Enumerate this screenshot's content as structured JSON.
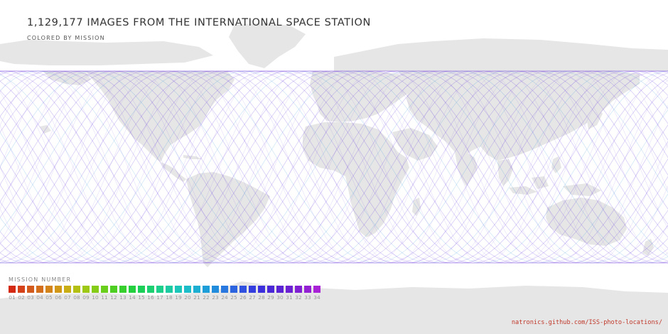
{
  "title": "1,129,177 IMAGES FROM THE INTERNATIONAL SPACE STATION",
  "subtitle": "COLORED BY MISSION",
  "legend": {
    "title": "MISSION NUMBER",
    "items": [
      {
        "label": "01",
        "color": "#d42a14"
      },
      {
        "label": "02",
        "color": "#d5421a"
      },
      {
        "label": "03",
        "color": "#d25a1c"
      },
      {
        "label": "04",
        "color": "#d36f1c"
      },
      {
        "label": "05",
        "color": "#d3841a"
      },
      {
        "label": "06",
        "color": "#d19818"
      },
      {
        "label": "07",
        "color": "#c9ad14"
      },
      {
        "label": "08",
        "color": "#b4bf14"
      },
      {
        "label": "09",
        "color": "#9ec816"
      },
      {
        "label": "10",
        "color": "#85cc18"
      },
      {
        "label": "11",
        "color": "#6ace1c"
      },
      {
        "label": "12",
        "color": "#4ece22"
      },
      {
        "label": "13",
        "color": "#36cf2e"
      },
      {
        "label": "14",
        "color": "#24cf40"
      },
      {
        "label": "15",
        "color": "#1ccf58"
      },
      {
        "label": "16",
        "color": "#1ccf70"
      },
      {
        "label": "17",
        "color": "#1ccf8a"
      },
      {
        "label": "18",
        "color": "#1ccba2"
      },
      {
        "label": "19",
        "color": "#1cc6b8"
      },
      {
        "label": "20",
        "color": "#1cbdc8"
      },
      {
        "label": "21",
        "color": "#1cafd2"
      },
      {
        "label": "22",
        "color": "#1e9ed8"
      },
      {
        "label": "23",
        "color": "#228cdc"
      },
      {
        "label": "24",
        "color": "#2878df"
      },
      {
        "label": "25",
        "color": "#2c64e0"
      },
      {
        "label": "26",
        "color": "#3050e0"
      },
      {
        "label": "27",
        "color": "#343edf"
      },
      {
        "label": "28",
        "color": "#3c30dc"
      },
      {
        "label": "29",
        "color": "#4a28d8"
      },
      {
        "label": "30",
        "color": "#5a24d4"
      },
      {
        "label": "31",
        "color": "#6c22d2"
      },
      {
        "label": "32",
        "color": "#8020d2"
      },
      {
        "label": "33",
        "color": "#9420d4"
      },
      {
        "label": "34",
        "color": "#a822d6"
      }
    ]
  },
  "source_link": "natronics.github.com/ISS-photo-locations/",
  "colors": {
    "land": "#e6e6e6",
    "ocean": "#ffffff",
    "track_primary": "#6a3ddf",
    "track_secondary": "#2a8cd8",
    "link": "#c0392b"
  }
}
